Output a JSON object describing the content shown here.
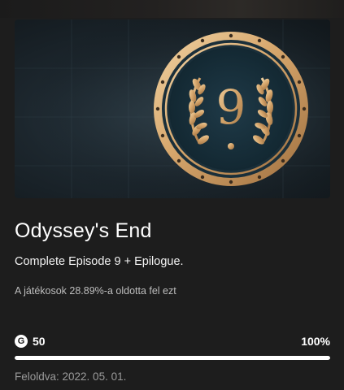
{
  "achievement": {
    "emblem_number": "9",
    "title": "Odyssey's End",
    "description": "Complete Episode 9 + Epilogue.",
    "unlock_stat": "A játékosok 28.89%-a oldotta fel ezt",
    "gamerscore_icon": "G",
    "gamerscore": "50",
    "progress_label": "100%",
    "progress_fraction": 1.0,
    "unlocked_date": "Feloldva: 2022. 05. 01."
  },
  "colors": {
    "background": "#1d1d1d",
    "gold": "#d8b07a",
    "progress_fill": "#ffffff",
    "progress_track": "#4a4a4a",
    "muted_text": "#9a9a9a"
  }
}
